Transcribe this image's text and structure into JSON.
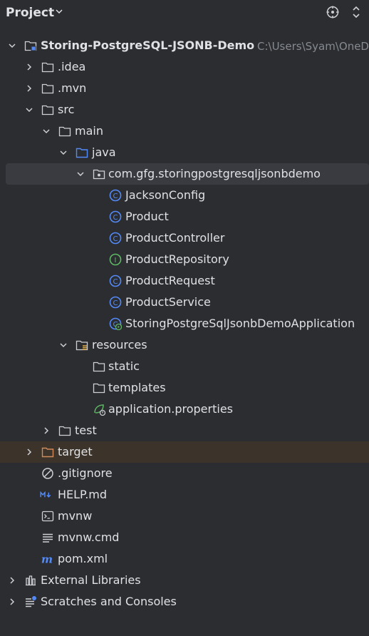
{
  "header": {
    "title": "Project",
    "chevron_icon": "chevron-down-icon",
    "locate_icon": "crosshair-icon",
    "expand_collapse_icon": "expand-collapse-icon"
  },
  "colors": {
    "background": "#2b2d30",
    "selected_row": "#393b40",
    "excluded_row": "#3c342a",
    "text": "#dfe1e5",
    "path_text": "#868a91",
    "class_icon": "#548af7",
    "interface_icon": "#5fb865",
    "excluded_folder": "#d08a5a"
  },
  "tree": {
    "project": {
      "name": "Storing-PostgreSQL-JSONB-Demo",
      "path": "C:\\Users\\Syam\\OneD"
    },
    "idea": ".idea",
    "mvn": ".mvn",
    "src": "src",
    "main": "main",
    "java": "java",
    "package": "com.gfg.storingpostgresqljsonbdemo",
    "classes": [
      {
        "name": "JacksonConfig",
        "kind": "class"
      },
      {
        "name": "Product",
        "kind": "class"
      },
      {
        "name": "ProductController",
        "kind": "class"
      },
      {
        "name": "ProductRepository",
        "kind": "interface"
      },
      {
        "name": "ProductRequest",
        "kind": "class"
      },
      {
        "name": "ProductService",
        "kind": "class"
      },
      {
        "name": "StoringPostgreSqlJsonbDemoApplication",
        "kind": "spring-boot-application"
      }
    ],
    "resources": "resources",
    "static": "static",
    "templates": "templates",
    "application_properties": "application.properties",
    "test": "test",
    "target": "target",
    "gitignore": ".gitignore",
    "help": "HELP.md",
    "mvnw": "mvnw",
    "mvnw_cmd": "mvnw.cmd",
    "pom": "pom.xml",
    "external_libraries": "External Libraries",
    "scratches": "Scratches and Consoles"
  }
}
